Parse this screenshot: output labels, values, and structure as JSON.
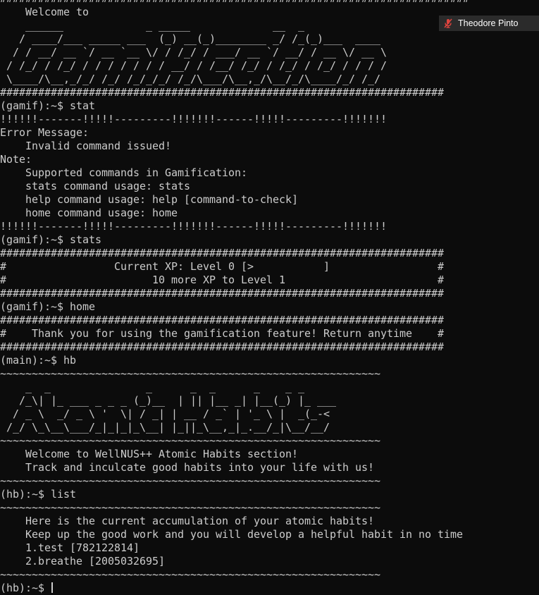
{
  "terminal": {
    "lines": [
      "##########################################################################",
      "    Welcome to",
      "    ______             _ _____             __  _",
      "   / ____/___ _____ ___  (_) __(_)________ _/ /_(_)___  ____",
      "  / / __/ __ `/ __ `__ \\/ / /_/ / ___/ __ `/ __/ / __ \\/ __ \\",
      " / /_/ / /_/ / / / / / / / __/ / /__/ /_/ / /_/ / /_/ / / / /",
      " \\____/\\__,_/_/ /_/ /_/_/_/ /_/\\___/\\__,_/\\__/_/\\____/_/ /_/",
      "######################################################################",
      "(gamif):~$ stat",
      "!!!!!!-------!!!!!---------!!!!!!!------!!!!!---------!!!!!!!",
      "Error Message:",
      "    Invalid command issued!",
      "Note:",
      "    Supported commands in Gamification:",
      "    stats command usage: stats",
      "    help command usage: help [command-to-check]",
      "    home command usage: home",
      "!!!!!!-------!!!!!---------!!!!!!!------!!!!!---------!!!!!!!",
      "(gamif):~$ stats",
      "######################################################################",
      "#                 Current XP: Level 0 [>           ]                 #",
      "#                       10 more XP to Level 1                        #",
      "######################################################################",
      "(gamif):~$ home",
      "######################################################################",
      "#    Thank you for using the gamification feature! Return anytime    #",
      "######################################################################",
      "(main):~$ hb",
      "~~~~~~~~~~~~~~~~~~~~~~~~~~~~~~~~~~~~~~~~~~~~~~~~~~~~~~~~~~~~",
      "    _  _               _      _  _      _    _ _",
      "   /_\\| |_ ___ _ _ _ (_)__  | || |__ _| |__(_) |_ ___",
      "  / _ \\  _/ _ \\ '  \\| / _| | __ / _` | '_ \\ |  _(_-<",
      " /_/ \\_\\__\\___/_|_|_|_\\__| |_||_\\__,_|_.__/_|\\__/__/",
      "~~~~~~~~~~~~~~~~~~~~~~~~~~~~~~~~~~~~~~~~~~~~~~~~~~~~~~~~~~~~",
      "    Welcome to WellNUS++ Atomic Habits section!",
      "    Track and inculcate good habits into your life with us!",
      "~~~~~~~~~~~~~~~~~~~~~~~~~~~~~~~~~~~~~~~~~~~~~~~~~~~~~~~~~~~~",
      "(hb):~$ list",
      "~~~~~~~~~~~~~~~~~~~~~~~~~~~~~~~~~~~~~~~~~~~~~~~~~~~~~~~~~~~~",
      "    Here is the current accumulation of your atomic habits!",
      "    Keep up the good work and you will develop a helpful habit in no time",
      "    1.test [782122814]",
      "    2.breathe [2005032695]",
      "~~~~~~~~~~~~~~~~~~~~~~~~~~~~~~~~~~~~~~~~~~~~~~~~~~~~~~~~~~~~"
    ],
    "prompt": "(hb):~$ "
  },
  "user_badge": {
    "name": "Theodore Pinto",
    "icon": "muted-microphone-icon",
    "icon_color": "#e0443e"
  },
  "colors": {
    "background": "#0c0c0c",
    "foreground": "#cccccc"
  }
}
